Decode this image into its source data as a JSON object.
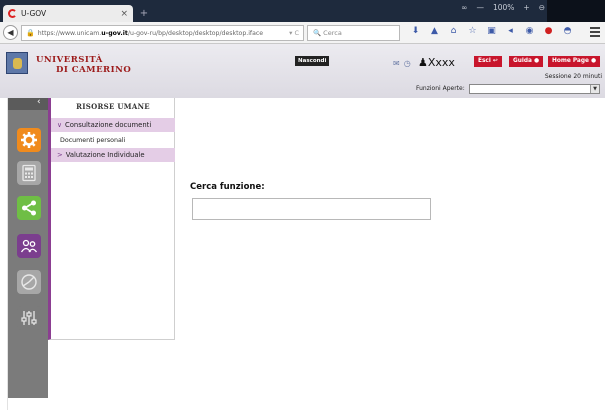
{
  "browser": {
    "tab_title": "U-GOV",
    "tab_close": "×",
    "new_tab": "+",
    "window_controls": [
      "∞",
      "—",
      "100%",
      "+",
      "⊖"
    ],
    "url_prefix": "https://www.unicam.",
    "url_host": "u-gov.it",
    "url_path": "/u-gov-ru/bp/desktop/desktop/desktop.iface",
    "url_tools": "▾ C",
    "search_placeholder": "Cerca"
  },
  "header": {
    "university_line1": "UNIVERSITÀ",
    "university_line2": "DI CAMERINO",
    "hide_label": "Nascondi",
    "user": "Xxxx",
    "btn_esci": "Esci",
    "btn_guida": "Guida",
    "btn_home": "Home Page",
    "session": "Sessione 20 minuti",
    "funzioni_label": "Funzioni Aperte:",
    "funzioni_value": ""
  },
  "rail": {
    "collapse_glyph": "‹",
    "colors": {
      "orange": "#f08b1d",
      "green": "#6fbe45",
      "purple": "#7b3e8e",
      "gray": "#a7a7a7"
    }
  },
  "sidemenu": {
    "title": "RISORSE UMANE",
    "items": [
      {
        "label": "Consultazione documenti",
        "expanded": true,
        "chevron": "∨"
      },
      {
        "label": "Documenti personali"
      },
      {
        "label": "Valutazione Individuale",
        "expanded": false,
        "chevron": ">"
      }
    ]
  },
  "main": {
    "search_label": "Cerca funzione:",
    "search_value": ""
  }
}
